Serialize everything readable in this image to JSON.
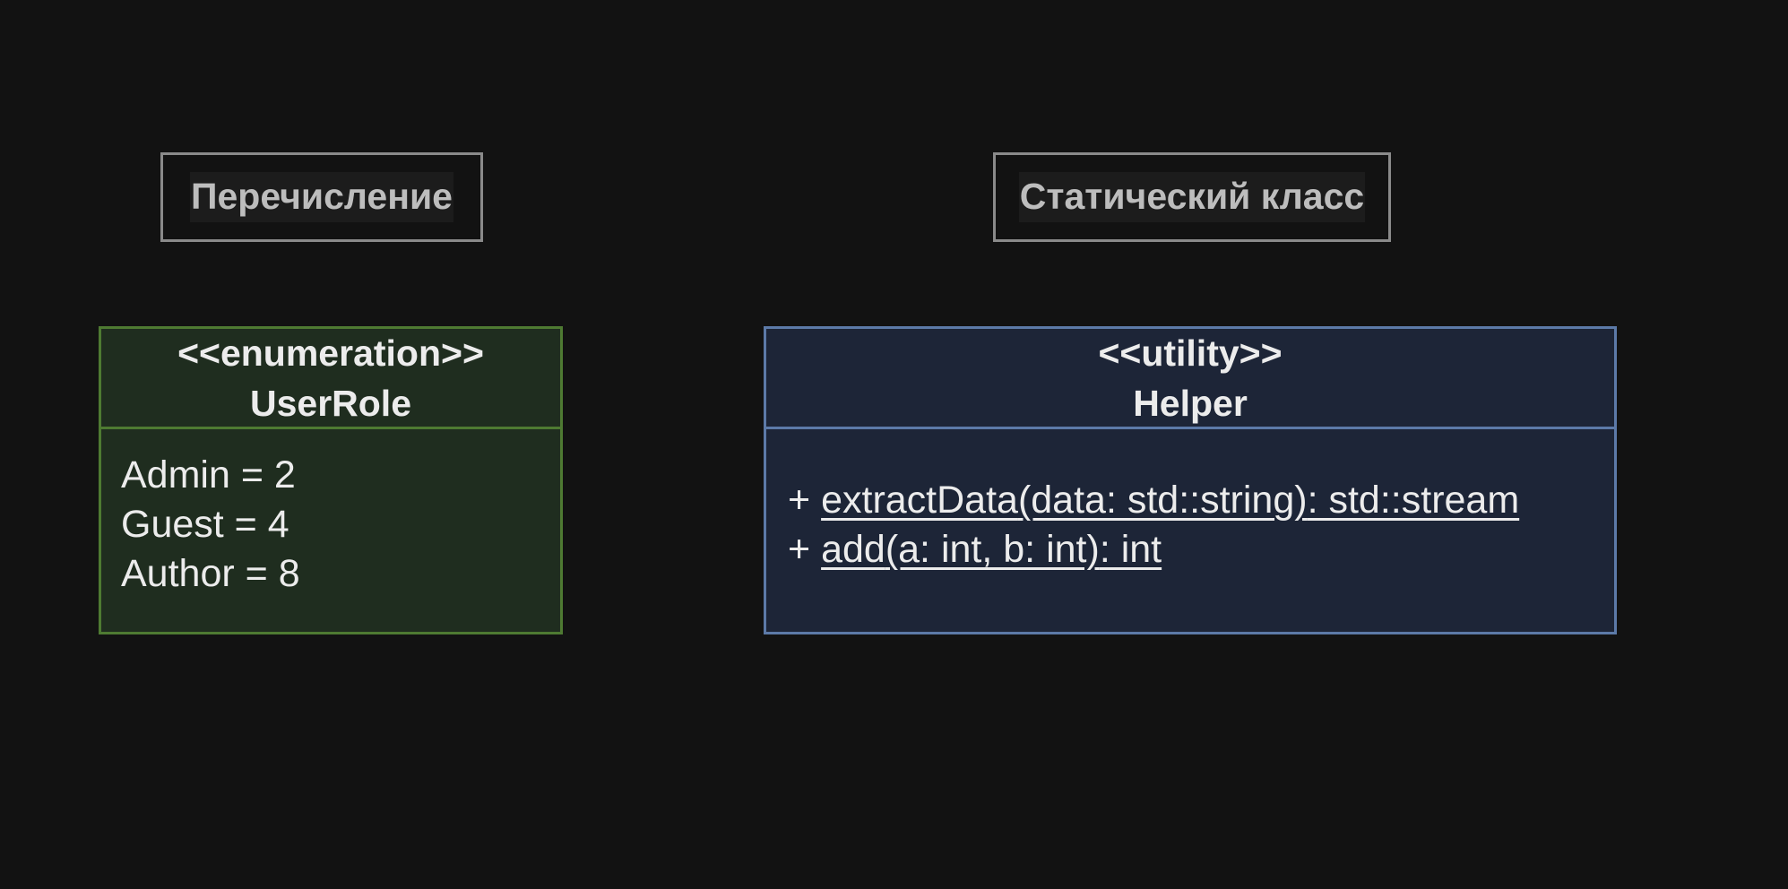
{
  "captions": {
    "enum": "Перечисление",
    "static": "Статический класс"
  },
  "enum_class": {
    "stereotype": "<<enumeration>>",
    "name": "UserRole",
    "values": [
      "Admin = 2",
      "Guest = 4",
      "Author = 8"
    ],
    "colors": {
      "fill": "#1f2d1f",
      "border": "#4e7a32"
    }
  },
  "utility_class": {
    "stereotype": "<<utility>>",
    "name": "Helper",
    "methods": [
      {
        "visibility": "+",
        "name": "extractData",
        "params": "(data: std::string)",
        "ret": ": std::stream"
      },
      {
        "visibility": "+",
        "name": "add",
        "params": "(a: int, b: int)",
        "ret": ": int"
      }
    ],
    "colors": {
      "fill": "#1d2537",
      "border": "#5c7aa8"
    }
  }
}
